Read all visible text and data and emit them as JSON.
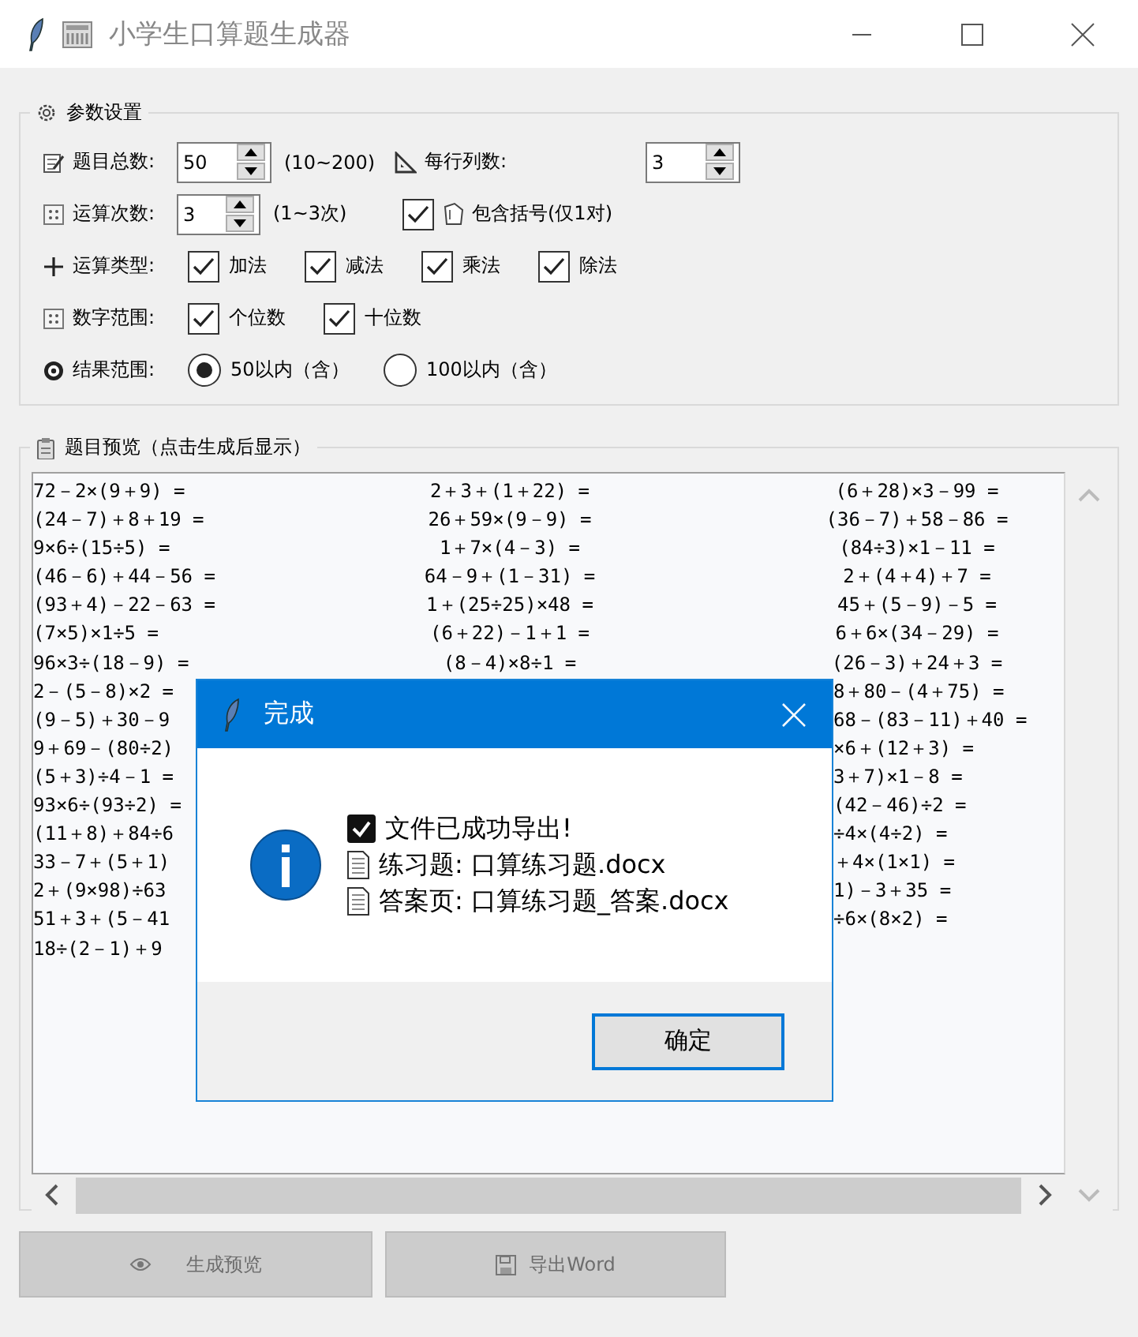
{
  "window": {
    "title": "小学生口算题生成器"
  },
  "settings": {
    "title": "参数设置",
    "total": {
      "label": "题目总数:",
      "value": "50",
      "hint": "(10~200)"
    },
    "columns": {
      "label": "每行列数:",
      "value": "3"
    },
    "operations": {
      "label": "运算次数:",
      "value": "3",
      "hint": "(1~3次)"
    },
    "brackets": {
      "label": "包含括号(仅1对)",
      "checked": true
    },
    "types": {
      "label": "运算类型:",
      "options": [
        {
          "label": "加法",
          "checked": true
        },
        {
          "label": "减法",
          "checked": true
        },
        {
          "label": "乘法",
          "checked": true
        },
        {
          "label": "除法",
          "checked": true
        }
      ]
    },
    "digits": {
      "label": "数字范围:",
      "options": [
        {
          "label": "个位数",
          "checked": true
        },
        {
          "label": "十位数",
          "checked": true
        }
      ]
    },
    "result": {
      "label": "结果范围:",
      "options": [
        {
          "label": "50以内（含）",
          "selected": true
        },
        {
          "label": "100以内（含）",
          "selected": false
        }
      ]
    }
  },
  "preview": {
    "title": "题目预览（点击生成后显示）",
    "rows": [
      {
        "kind": "full",
        "cells": [
          "72－2×(9＋9) =",
          "2＋3＋(1＋22) =",
          "(6＋28)×3－99 ="
        ]
      },
      {
        "kind": "full",
        "cells": [
          "(24－7)＋8＋19 =",
          "26＋59×(9－9) =",
          "(36－7)＋58－86 ="
        ]
      },
      {
        "kind": "full",
        "cells": [
          "9×6÷(15÷5) =",
          "1＋7×(4－3) =",
          "(84÷3)×1－11 ="
        ]
      },
      {
        "kind": "full",
        "cells": [
          "(46－6)＋44－56 =",
          "64－9＋(1－31) =",
          "2＋(4＋4)＋7 ="
        ]
      },
      {
        "kind": "full",
        "cells": [
          "(93＋4)－22－63 =",
          "1＋(25÷25)×48 =",
          "45＋(5－9)－5 ="
        ]
      },
      {
        "kind": "full",
        "cells": [
          "(7×5)×1÷5 =",
          "(6＋22)－1＋1 =",
          "6＋6×(34－29) ="
        ]
      },
      {
        "kind": "full",
        "cells": [
          "96×3÷(18－9) =",
          "(8－4)×8÷1 =",
          "(26－3)＋24＋3 ="
        ]
      },
      {
        "kind": "covered",
        "cells": [
          "2－(5－8)×2 =",
          "8＋80－(4＋75) ="
        ]
      },
      {
        "kind": "covered",
        "cells": [
          "(9－5)＋30－9",
          "68－(83－11)＋40 ="
        ]
      },
      {
        "kind": "covered",
        "cells": [
          "9＋69－(80÷2)",
          "×6＋(12＋3) ="
        ]
      },
      {
        "kind": "covered",
        "cells": [
          "(5＋3)÷4－1 =",
          "3＋7)×1－8 ="
        ]
      },
      {
        "kind": "covered",
        "cells": [
          "93×6÷(93÷2) =",
          "(42－46)÷2 ="
        ]
      },
      {
        "kind": "covered",
        "cells": [
          "(11＋8)＋84÷6",
          "÷4×(4÷2) ="
        ]
      },
      {
        "kind": "covered",
        "cells": [
          "33－7＋(5＋1)",
          "＋4×(1×1) ="
        ]
      },
      {
        "kind": "covered",
        "cells": [
          "2＋(9×98)÷63",
          "1)－3＋35 ="
        ]
      },
      {
        "kind": "covered",
        "cells": [
          "51＋3＋(5－41",
          "÷6×(8×2) ="
        ]
      },
      {
        "kind": "covered",
        "cells": [
          "18÷(2－1)＋9"
        ]
      }
    ]
  },
  "buttons": [
    {
      "label": "生成预览"
    },
    {
      "label": "导出Word"
    }
  ],
  "dialog": {
    "title": "完成",
    "lines": [
      {
        "kind": "success",
        "text": "文件已成功导出!"
      },
      {
        "kind": "file",
        "text": "练习题: 口算练习题.docx"
      },
      {
        "kind": "file",
        "text": "答案页: 口算练习题_答案.docx"
      }
    ],
    "button": "确定"
  }
}
